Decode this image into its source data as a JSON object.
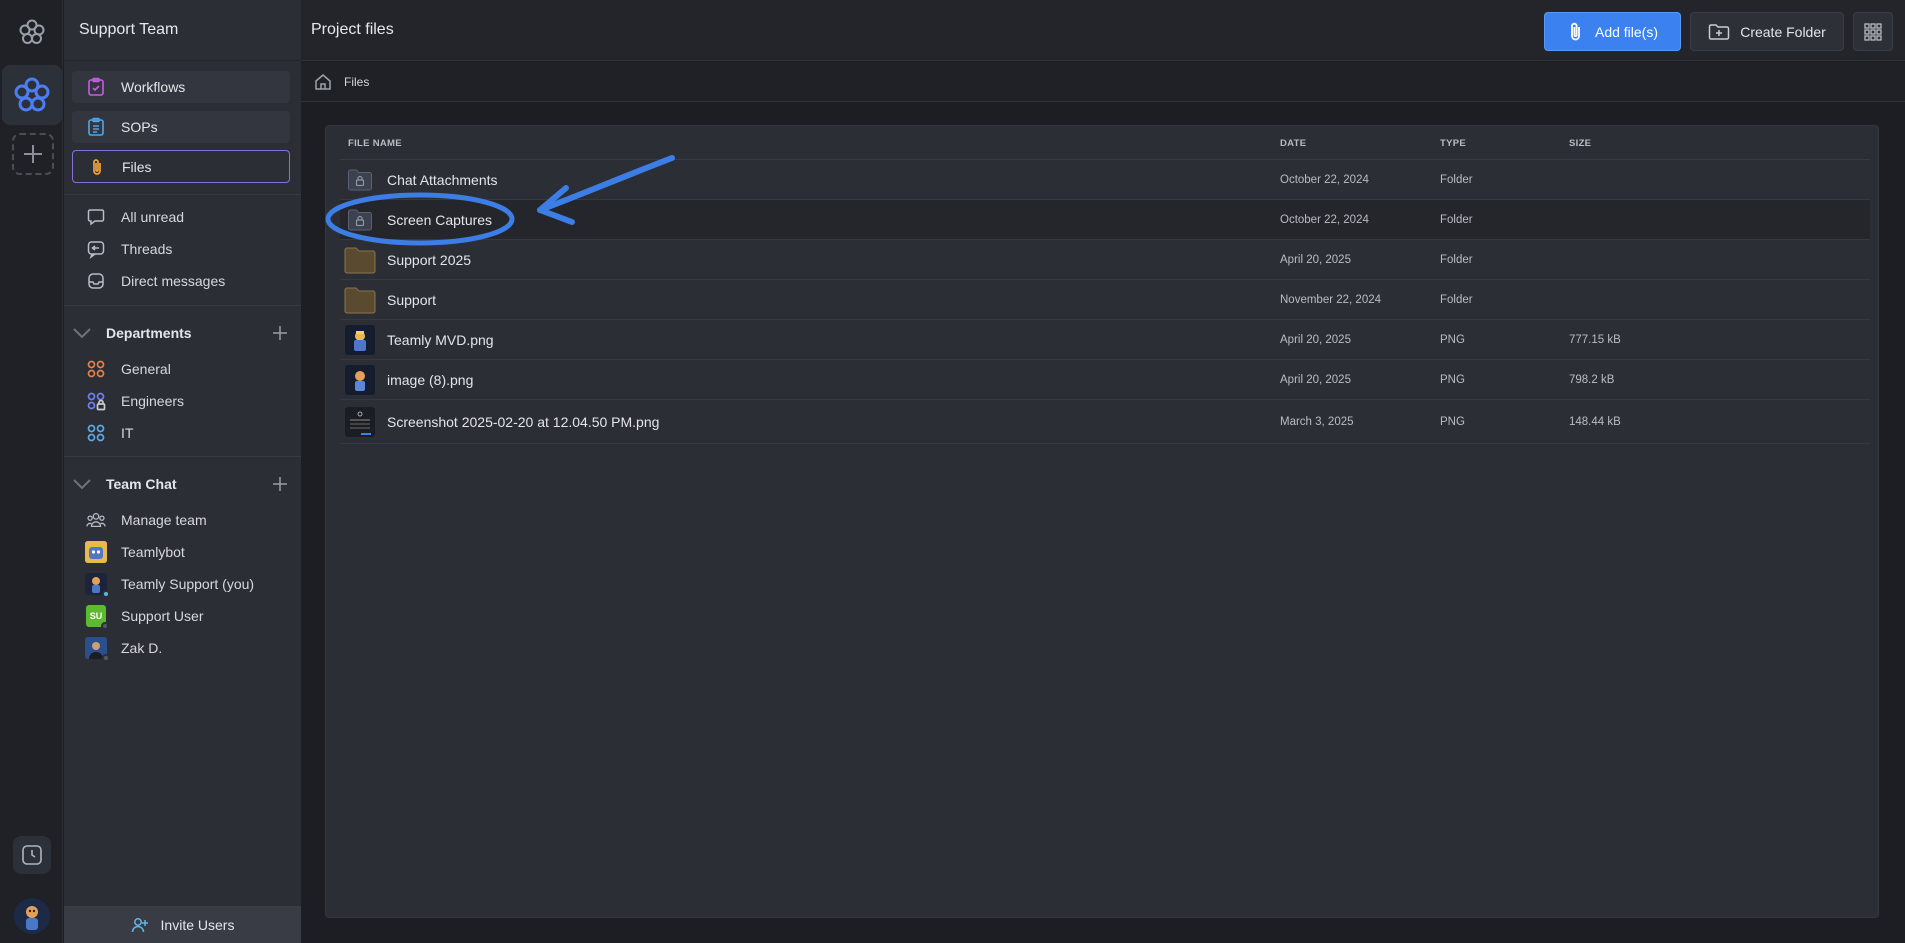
{
  "sidebar": {
    "team_name": "Support Team",
    "nav": [
      {
        "label": "Workflows",
        "icon": "clipboard-check-icon"
      },
      {
        "label": "SOPs",
        "icon": "list-document-icon"
      },
      {
        "label": "Files",
        "icon": "paperclip-icon",
        "active": true
      }
    ],
    "quick": [
      {
        "label": "All unread",
        "icon": "chat-bubble-icon"
      },
      {
        "label": "Threads",
        "icon": "thread-icon"
      },
      {
        "label": "Direct messages",
        "icon": "inbox-icon"
      }
    ],
    "departments": {
      "title": "Departments",
      "items": [
        {
          "label": "General",
          "icon": "channel-grid-icon",
          "color": "#e0804a"
        },
        {
          "label": "Engineers",
          "icon": "channel-grid-lock-icon",
          "color": "#6f7ff0"
        },
        {
          "label": "IT",
          "icon": "channel-grid-icon",
          "color": "#5aa9e6"
        }
      ]
    },
    "team_chat": {
      "title": "Team Chat",
      "items": [
        {
          "label": "Manage team",
          "icon": "people-icon"
        },
        {
          "label": "Teamlybot",
          "avatar": "bot"
        },
        {
          "label": "Teamly Support (you)",
          "avatar": "support"
        },
        {
          "label": "Support User",
          "avatar": "initials",
          "initials": "SU"
        },
        {
          "label": "Zak D.",
          "avatar": "photo"
        }
      ]
    },
    "invite_label": "Invite Users"
  },
  "header": {
    "title": "Project files",
    "add_files_label": "Add file(s)",
    "create_folder_label": "Create Folder"
  },
  "breadcrumb": {
    "items": [
      "Files"
    ]
  },
  "table": {
    "columns": [
      "FILE NAME",
      "DATE",
      "TYPE",
      "SIZE"
    ],
    "rows": [
      {
        "name": "Chat Attachments",
        "date": "October 22, 2024",
        "type": "Folder",
        "size": "",
        "icon": "locked-folder-icon"
      },
      {
        "name": "Screen Captures",
        "date": "October 22, 2024",
        "type": "Folder",
        "size": "",
        "icon": "locked-folder-icon"
      },
      {
        "name": "Support 2025",
        "date": "April 20, 2025",
        "type": "Folder",
        "size": "",
        "icon": "folder-icon"
      },
      {
        "name": "Support",
        "date": "November 22, 2024",
        "type": "Folder",
        "size": "",
        "icon": "folder-icon"
      },
      {
        "name": "Teamly MVD.png",
        "date": "April 20, 2025",
        "type": "PNG",
        "size": "777.15 kB",
        "icon": "image-thumbnail"
      },
      {
        "name": "image (8).png",
        "date": "April 20, 2025",
        "type": "PNG",
        "size": "798.2 kB",
        "icon": "image-thumbnail"
      },
      {
        "name": "Screenshot 2025-02-20 at 12.04.50 PM.png",
        "date": "March 3, 2025",
        "type": "PNG",
        "size": "148.44 kB",
        "icon": "image-thumbnail"
      }
    ]
  },
  "colors": {
    "accent_blue": "#3b82f0",
    "active_border": "#8b6fd8",
    "annotation": "#3d7de6"
  }
}
